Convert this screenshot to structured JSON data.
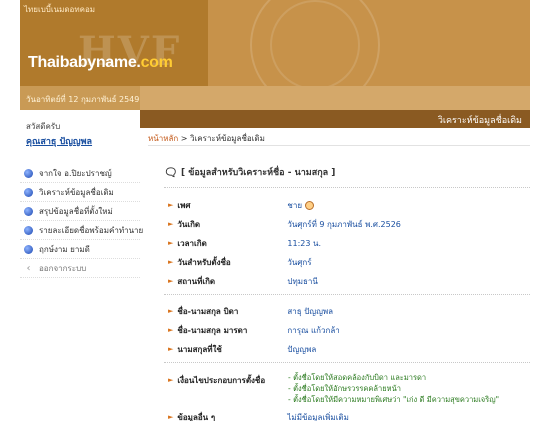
{
  "site": {
    "tagline": "ไทยเบบี้เนมดอทคอม",
    "logo_main": "Thaibabyname.",
    "logo_ext": "com",
    "watermark": "HVF"
  },
  "datebar": {
    "text": "วันอาทิตย์ที่ 12 กุมภาพันธ์ 2549"
  },
  "page_title": "วิเคราะห์ข้อมูลชื่อเดิม",
  "sidebar": {
    "greeting": "สวัสดีครับ",
    "username": "คุณสาธุ ปัญญพล",
    "items": [
      {
        "label": "จากใจ อ.ปิยะปราชญ์",
        "icon": "blue-ball-icon"
      },
      {
        "label": "วิเคราะห์ข้อมูลชื่อเดิม",
        "icon": "blue-ball-icon"
      },
      {
        "label": "สรุปข้อมูลชื่อที่ตั้งใหม่",
        "icon": "blue-ball-icon"
      },
      {
        "label": "รายละเอียดชื่อพร้อมคำทำนาย",
        "icon": "blue-ball-icon"
      },
      {
        "label": "ฤกษ์งาม ยามดี",
        "icon": "blue-ball-icon"
      }
    ],
    "logout": {
      "label": "ออกจากระบบ",
      "icon": "chevron-left-icon"
    }
  },
  "breadcrumb": {
    "home": "หน้าหลัก",
    "separator": " > ",
    "current": "วิเคราะห์ข้อมูลชื่อเดิม"
  },
  "section": {
    "icon": "speech-bubble-icon",
    "title": "[ ข้อมูลสำหรับวิเคราะห์ชื่อ - นามสกุล ]"
  },
  "fields": {
    "gender": {
      "label": "เพศ",
      "value": "ชาย"
    },
    "birthdate": {
      "label": "วันเกิด",
      "value": "วันศุกร์ที่ 9 กุมภาพันธ์ พ.ศ.2526"
    },
    "birthtime": {
      "label": "เวลาเกิด",
      "value": "11:23 น."
    },
    "naming_day": {
      "label": "วันสำหรับตั้งชื่อ",
      "value": "วันศุกร์"
    },
    "birthplace": {
      "label": "สถานที่เกิด",
      "value": "ปทุมธานี"
    },
    "father": {
      "label": "ชื่อ-นามสกุล บิดา",
      "value": "สาธุ ปัญญพล"
    },
    "mother": {
      "label": "ชื่อ-นามสกุล มารดา",
      "value": "การุณ แก้วกล้า"
    },
    "surname": {
      "label": "นามสกุลที่ใช้",
      "value": "ปัญญพล"
    },
    "conditions": {
      "label": "เงื่อนไขประกอบการตั้งชื่อ",
      "lines": [
        "- ตั้งชื่อโดยให้สอดคล้องกับบิดา และมารดา",
        "- ตั้งชื่อโดยให้อักษรวรรคคล้ายหน้า",
        "- ตั้งชื่อโดยให้มีความหมายพิเศษว่า \"เก่ง ดี มีความสุขความเจริญ\""
      ]
    },
    "other": {
      "label": "ข้อมูลอื่น ๆ",
      "value": "ไม่มีข้อมูลเพิ่มเติม"
    }
  }
}
